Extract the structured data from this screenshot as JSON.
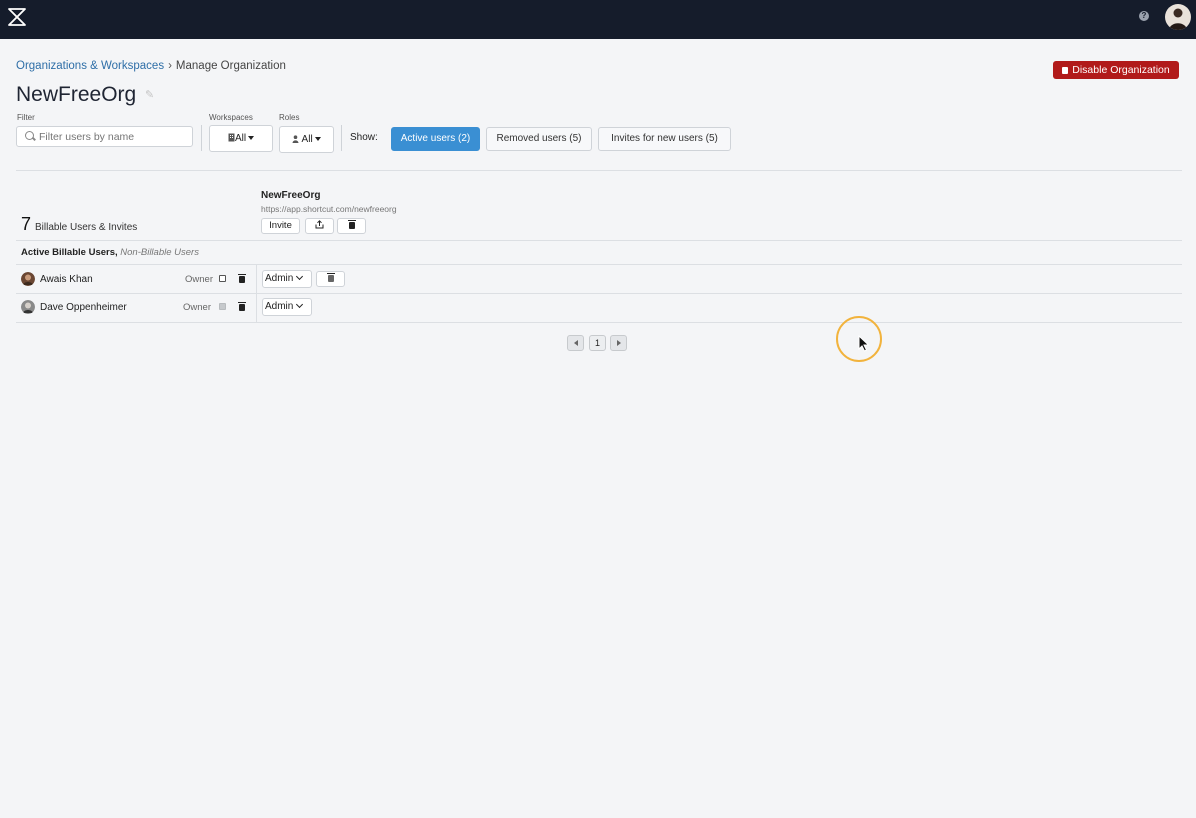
{
  "header": {
    "logo": "shortcut-logo",
    "help_icon_text": "?"
  },
  "breadcrumb": {
    "link": "Organizations & Workspaces",
    "separator": "›",
    "current": "Manage Organization"
  },
  "actions": {
    "disable_label": "Disable Organization"
  },
  "page": {
    "title": "NewFreeOrg"
  },
  "filters": {
    "filter_label": "Filter",
    "filter_placeholder": "Filter users by name",
    "workspaces_label": "Workspaces",
    "workspaces_value": "All",
    "roles_label": "Roles",
    "roles_value": "All",
    "show_label": "Show:",
    "tabs": [
      {
        "label": "Active users (2)",
        "active": true
      },
      {
        "label": "Removed users (5)",
        "active": false
      },
      {
        "label": "Invites for new users (5)",
        "active": false
      }
    ]
  },
  "summary": {
    "count": "7",
    "count_label": "Billable Users & Invites"
  },
  "workspace": {
    "name": "NewFreeOrg",
    "url": "https://app.shortcut.com/newfreeorg",
    "invite_label": "Invite"
  },
  "section": {
    "title_bold": "Active Billable Users,",
    "title_italic": "Non-Billable Users"
  },
  "users": [
    {
      "name": "Awais Khan",
      "owner_label": "Owner",
      "owner_checked": false,
      "role": "Admin",
      "removable": true
    },
    {
      "name": "Dave Oppenheimer",
      "owner_label": "Owner",
      "owner_checked": true,
      "role": "Admin",
      "removable": false
    }
  ],
  "pagination": {
    "current_page": "1"
  },
  "colors": {
    "topbar": "#151c2b",
    "danger": "#b11a1a",
    "active_tab": "#3a8fd3",
    "link": "#2e6ea7",
    "cursor_ring": "#f2b33d"
  }
}
